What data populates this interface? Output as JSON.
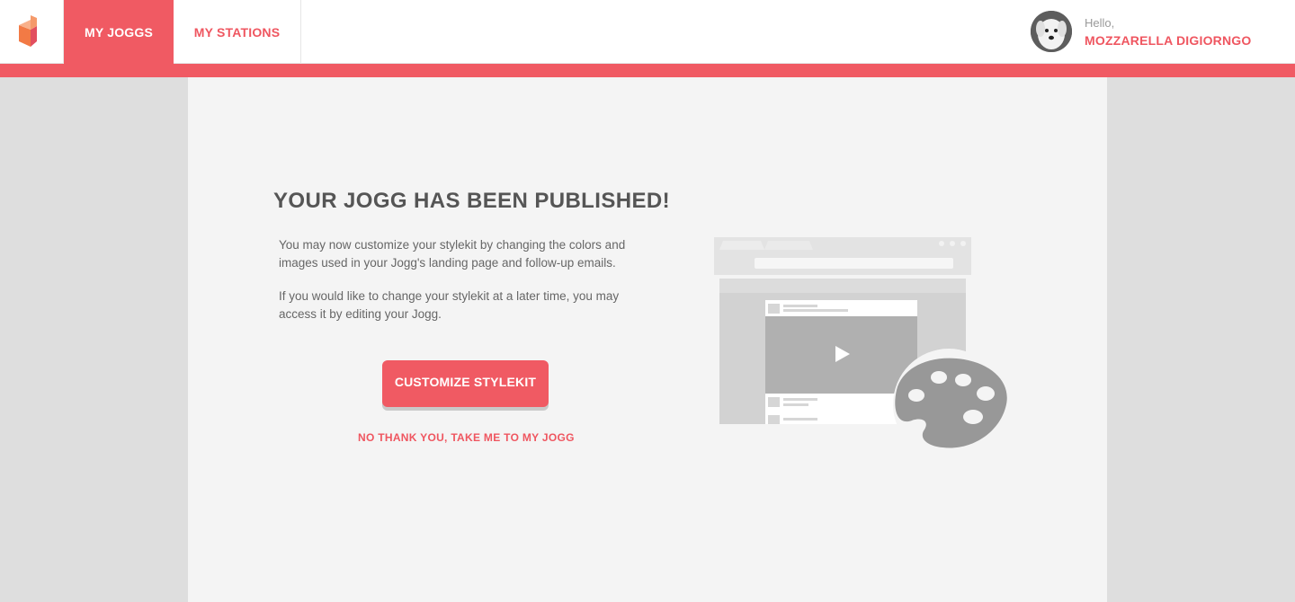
{
  "nav": {
    "logo_icon": "jogg-logo-icon",
    "tabs": [
      {
        "label": "MY JOGGS",
        "active": true
      },
      {
        "label": "MY STATIONS",
        "active": false
      }
    ]
  },
  "user": {
    "greeting": "Hello,",
    "name": "MOZZARELLA DIGIORNGO",
    "avatar_icon": "dog-avatar"
  },
  "main": {
    "title": "YOUR JOGG HAS BEEN PUBLISHED!",
    "paragraph1": "You may now customize your stylekit by changing the colors and images used in your Jogg's landing page and follow-up emails.",
    "paragraph2": "If you would like to change your stylekit at a later time, you may access it by editing your Jogg.",
    "primary_button": "CUSTOMIZE STYLEKIT",
    "secondary_link": "NO THANK YOU, TAKE ME TO MY JOGG",
    "illustration_icons": [
      "browser-window-icon",
      "play-icon",
      "palette-icon"
    ]
  },
  "colors": {
    "accent": "#f05a63",
    "background": "#dedede",
    "panel": "#f4f4f4",
    "heading": "#555555"
  }
}
